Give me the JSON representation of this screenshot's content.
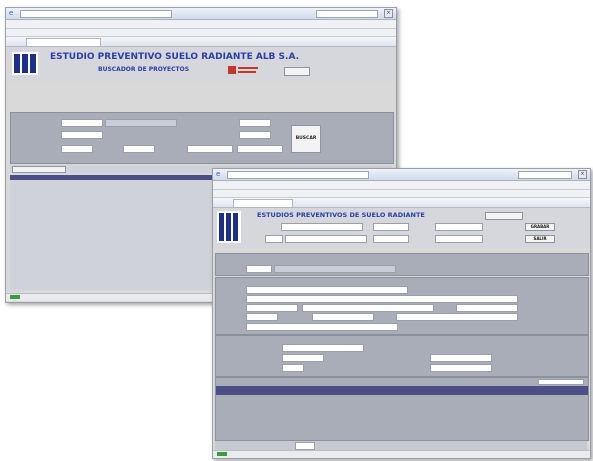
{
  "window1": {
    "header_title": "ESTUDIO PREVENTIVO SUELO RADIANTE ALB S.A.",
    "header_subtitle": "BUSCADOR DE PROYECTOS",
    "search_button": "BUSCAR"
  },
  "window2": {
    "header_title": "ESTUDIOS PREVENTIVOS DE SUELO RADIANTE",
    "guardar_button": "GRABAR",
    "salir_button": "SALIR"
  },
  "colors": {
    "logo_blue": "#1c2f8a",
    "title_blue": "#2b3fa8",
    "subtitle_red": "#c0392b",
    "grid_header": "#4c4f86",
    "panel_gray": "#a8adb8"
  }
}
